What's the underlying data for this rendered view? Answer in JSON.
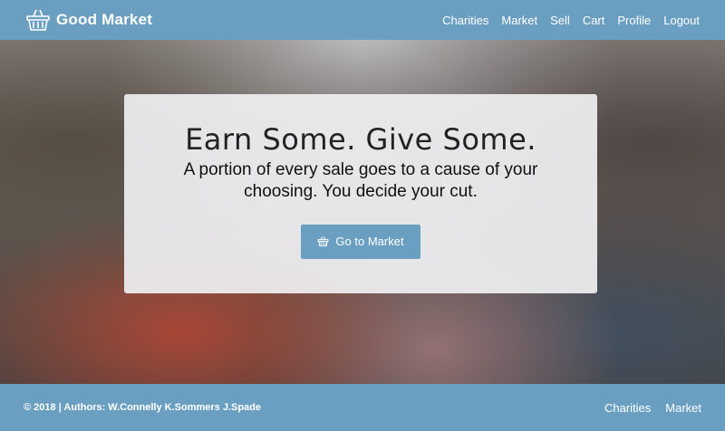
{
  "brand": {
    "name": "Good Market",
    "icon": "basket-icon"
  },
  "nav": {
    "links": [
      "Charities",
      "Market",
      "Sell",
      "Cart",
      "Profile",
      "Logout"
    ]
  },
  "hero": {
    "title": "Earn Some. Give Some.",
    "subtitle": "A portion of every sale goes to a cause of your choosing. You decide your cut.",
    "button_label": "Go to Market",
    "button_icon": "basket-icon"
  },
  "footer": {
    "text": "© 2018 | Authors: W.Connelly K.Sommers J.Spade",
    "links": [
      "Charities",
      "Market"
    ]
  },
  "colors": {
    "primary": "#6a9fc1",
    "card": "#f0f0f2"
  }
}
